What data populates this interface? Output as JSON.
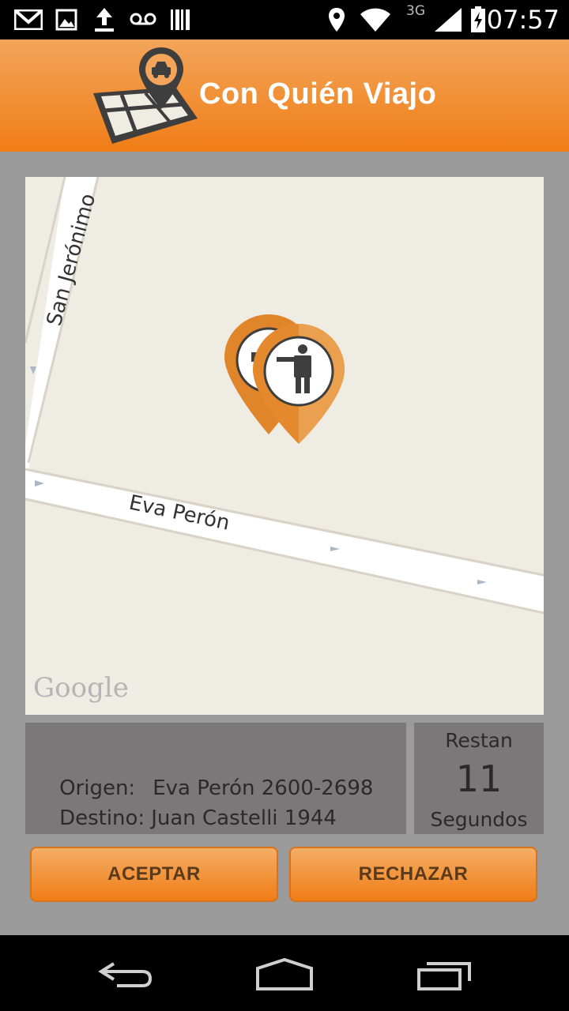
{
  "status_bar": {
    "time": "07:57",
    "network": "3G",
    "icons": [
      "gmail-icon",
      "gallery-icon",
      "upload-icon",
      "voicemail-icon",
      "barcode-icon",
      "location-icon",
      "wifi-icon",
      "signal-icon",
      "battery-charging-icon"
    ]
  },
  "app": {
    "title": "Con Quién Viajo",
    "brand_color": "#f07d16"
  },
  "map": {
    "streets": [
      "San Jerónimo",
      "Eva Perón"
    ],
    "attribution": "Google",
    "markers": [
      "taxi-marker-icon",
      "passenger-marker-icon"
    ]
  },
  "trip": {
    "origin_label": "Origen:",
    "origin_value": "Eva Perón 2600-2698",
    "destination_label": "Destino:",
    "destination_value": "Juan Castelli 1944"
  },
  "countdown": {
    "top_label": "Restan",
    "value": "11",
    "bottom_label": "Segundos"
  },
  "actions": {
    "accept": "ACEPTAR",
    "reject": "RECHAZAR"
  },
  "nav": {
    "icons": [
      "back-icon",
      "home-icon",
      "recent-apps-icon"
    ]
  }
}
